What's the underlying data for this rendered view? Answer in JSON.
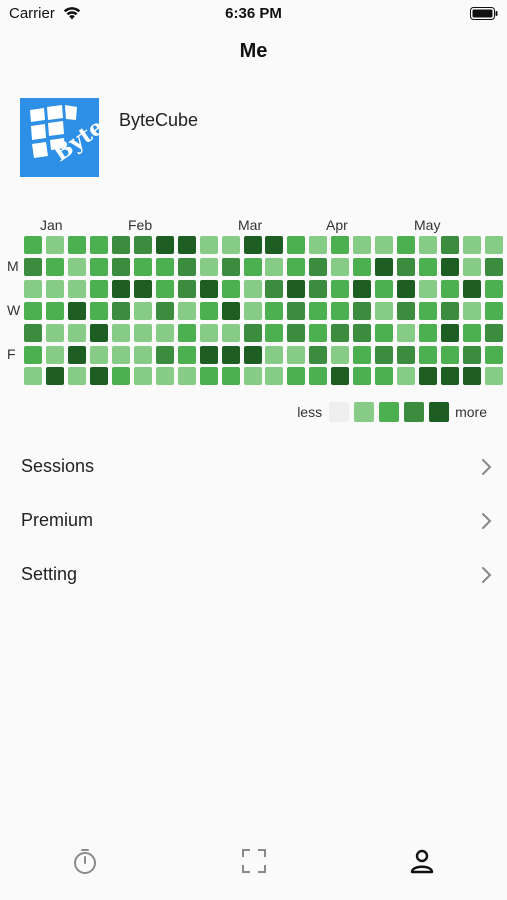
{
  "status_bar": {
    "carrier": "Carrier",
    "time": "6:36 PM"
  },
  "nav": {
    "title": "Me"
  },
  "profile": {
    "name": "ByteCube",
    "logo_text": "Byte",
    "logo_color": "#2e8fe6"
  },
  "heatmap": {
    "months": [
      "Jan",
      "Feb",
      "Mar",
      "Apr",
      "May"
    ],
    "days": [
      "M",
      "W",
      "F"
    ],
    "colors": [
      "#eeeeee",
      "#86cc86",
      "#4caf50",
      "#3b8c3f",
      "#1e5e22"
    ],
    "grid": [
      [
        2,
        1,
        2,
        2,
        3,
        3,
        4,
        4,
        1,
        1,
        4,
        4,
        2,
        1,
        2,
        1,
        1,
        2,
        1,
        3,
        1,
        1
      ],
      [
        3,
        2,
        1,
        2,
        3,
        2,
        2,
        3,
        1,
        3,
        2,
        1,
        2,
        3,
        1,
        2,
        4,
        3,
        2,
        4,
        1,
        3
      ],
      [
        1,
        1,
        1,
        2,
        4,
        4,
        2,
        3,
        4,
        2,
        1,
        3,
        4,
        3,
        2,
        4,
        2,
        4,
        1,
        2,
        4,
        2
      ],
      [
        2,
        2,
        4,
        2,
        3,
        1,
        3,
        1,
        2,
        4,
        1,
        2,
        3,
        2,
        2,
        3,
        1,
        3,
        2,
        3,
        1,
        2
      ],
      [
        3,
        1,
        1,
        4,
        1,
        1,
        1,
        2,
        1,
        1,
        3,
        2,
        3,
        2,
        3,
        3,
        2,
        1,
        2,
        4,
        2,
        3
      ],
      [
        2,
        1,
        4,
        1,
        1,
        1,
        3,
        2,
        4,
        4,
        4,
        1,
        1,
        3,
        1,
        2,
        3,
        3,
        2,
        2,
        3,
        2
      ],
      [
        1,
        4,
        1,
        4,
        2,
        1,
        1,
        1,
        2,
        2,
        1,
        1,
        2,
        2,
        4,
        2,
        2,
        1,
        4,
        4,
        4,
        1
      ]
    ]
  },
  "legend": {
    "less": "less",
    "more": "more"
  },
  "menu": [
    {
      "label": "Sessions"
    },
    {
      "label": "Premium"
    },
    {
      "label": "Setting"
    }
  ],
  "tabs": [
    {
      "icon": "timer-icon"
    },
    {
      "icon": "scan-icon"
    },
    {
      "icon": "person-icon",
      "active": true
    }
  ]
}
